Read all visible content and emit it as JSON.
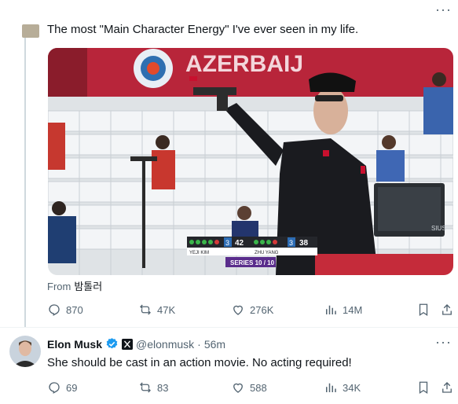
{
  "top_tweet": {
    "text": "The most \"Main Character Energy\" I've ever seen in my life.",
    "source_prefix": "From",
    "source_name": "밤톨러",
    "media": {
      "banner_text": "AZERBAIJ",
      "scoreboard": {
        "left_name": "YEJI KIM",
        "left_series": "3",
        "left_score": "42",
        "right_name": "ZHU YANG",
        "right_series": "3",
        "right_score": "38",
        "series_label": "SERIES 10 / 10"
      },
      "monitor_brand": "SIUS"
    },
    "stats": {
      "replies": "870",
      "reposts": "47K",
      "likes": "276K",
      "views": "14M"
    }
  },
  "reply": {
    "name": "Elon Musk",
    "handle": "@elonmusk",
    "separator": "·",
    "time": "56m",
    "text": "She should be cast in an action movie. No  acting required!",
    "stats": {
      "replies": "69",
      "reposts": "83",
      "likes": "588",
      "views": "34K"
    }
  },
  "more_symbol": "···",
  "colors": {
    "text_primary": "#0f1419",
    "text_secondary": "#536471",
    "verified_blue": "#1d9bf0",
    "divider": "#eff3f4"
  },
  "icons": [
    "reply-icon",
    "repost-icon",
    "like-icon",
    "views-icon",
    "bookmark-icon",
    "share-icon",
    "verified-badge-icon",
    "x-logo-icon",
    "more-icon"
  ]
}
